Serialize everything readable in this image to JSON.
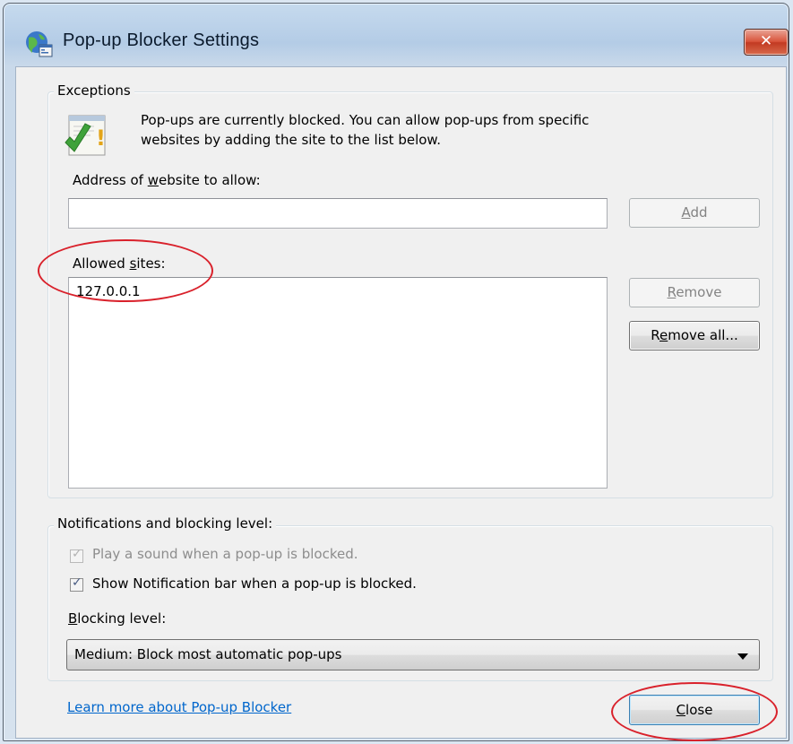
{
  "window": {
    "title": "Pop-up Blocker Settings",
    "icon": "internet-options-globe-icon",
    "close_glyph": "✕"
  },
  "exceptions": {
    "group_label": "Exceptions",
    "info_icon": "popup-blocked-warning-icon",
    "info_line1": "Pop-ups are currently blocked.  You can allow pop-ups from specific",
    "info_line2": "websites by adding the site to the list below.",
    "address_label": {
      "pre": "Address of ",
      "accel": "w",
      "post": "ebsite to allow:"
    },
    "address_value": "",
    "add_button": {
      "pre": "",
      "accel": "A",
      "post": "dd",
      "enabled": false
    },
    "allowed_label": {
      "pre": "Allowed ",
      "accel": "s",
      "post": "ites:"
    },
    "allowed_sites": [
      "127.0.0.1"
    ],
    "remove_button": {
      "pre": "",
      "accel": "R",
      "post": "emove",
      "enabled": false
    },
    "remove_all_button": {
      "pre": "R",
      "accel": "e",
      "post": "move all...",
      "enabled": true
    }
  },
  "notifications": {
    "group_label": "Notifications and blocking level:",
    "play_sound": {
      "label": "Play a sound when a pop-up is blocked.",
      "checked": true,
      "enabled": false
    },
    "show_bar": {
      "label": "Show Notification bar when a pop-up is blocked.",
      "checked": true,
      "enabled": true
    },
    "blocking_label": {
      "pre": "",
      "accel": "B",
      "post": "locking level:"
    },
    "blocking_value": "Medium: Block most automatic pop-ups"
  },
  "footer": {
    "learn_more": "Learn more about Pop-up Blocker",
    "close_button": {
      "pre": "",
      "accel": "C",
      "post": "lose"
    }
  },
  "annotations": {
    "highlight_color": "#d9212b"
  },
  "colors": {
    "link": "#0066cc",
    "title_bar": "#b4cce6",
    "dialog_bg": "#f0f0f0"
  }
}
